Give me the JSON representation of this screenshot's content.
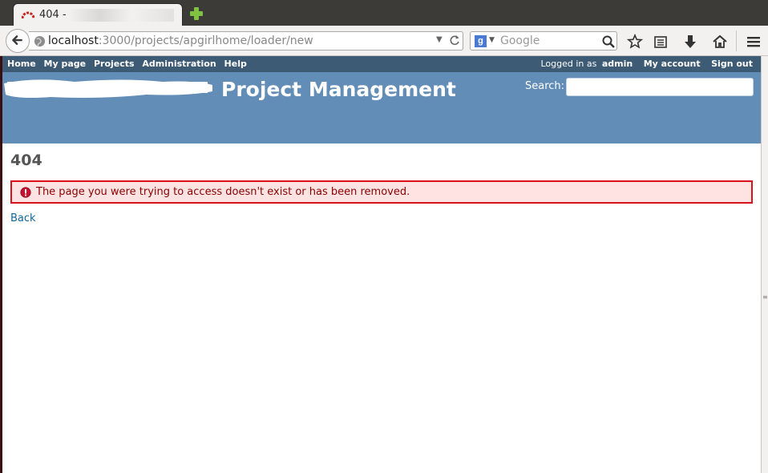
{
  "browser": {
    "tab_title": "404 - ",
    "url_host": "localhost",
    "url_rest": ":3000/projects/apgirlhome/loader/new",
    "search_engine": "Google"
  },
  "top_menu": {
    "items": [
      "Home",
      "My page",
      "Projects",
      "Administration",
      "Help"
    ],
    "logged_in_label": "Logged in as",
    "user": "admin",
    "my_account": "My account",
    "sign_out": "Sign out"
  },
  "header": {
    "title": "Project Management",
    "search_label": "Search:"
  },
  "content": {
    "heading": "404",
    "error_message": "The page you were trying to access doesn't exist or has been removed.",
    "back_link": "Back"
  },
  "colors": {
    "top_menu_bg": "#3e5b76",
    "header_bg": "#628db6",
    "error_bg": "#ffe3e3",
    "error_border": "#d7141a",
    "error_text": "#880000",
    "link": "#169"
  }
}
